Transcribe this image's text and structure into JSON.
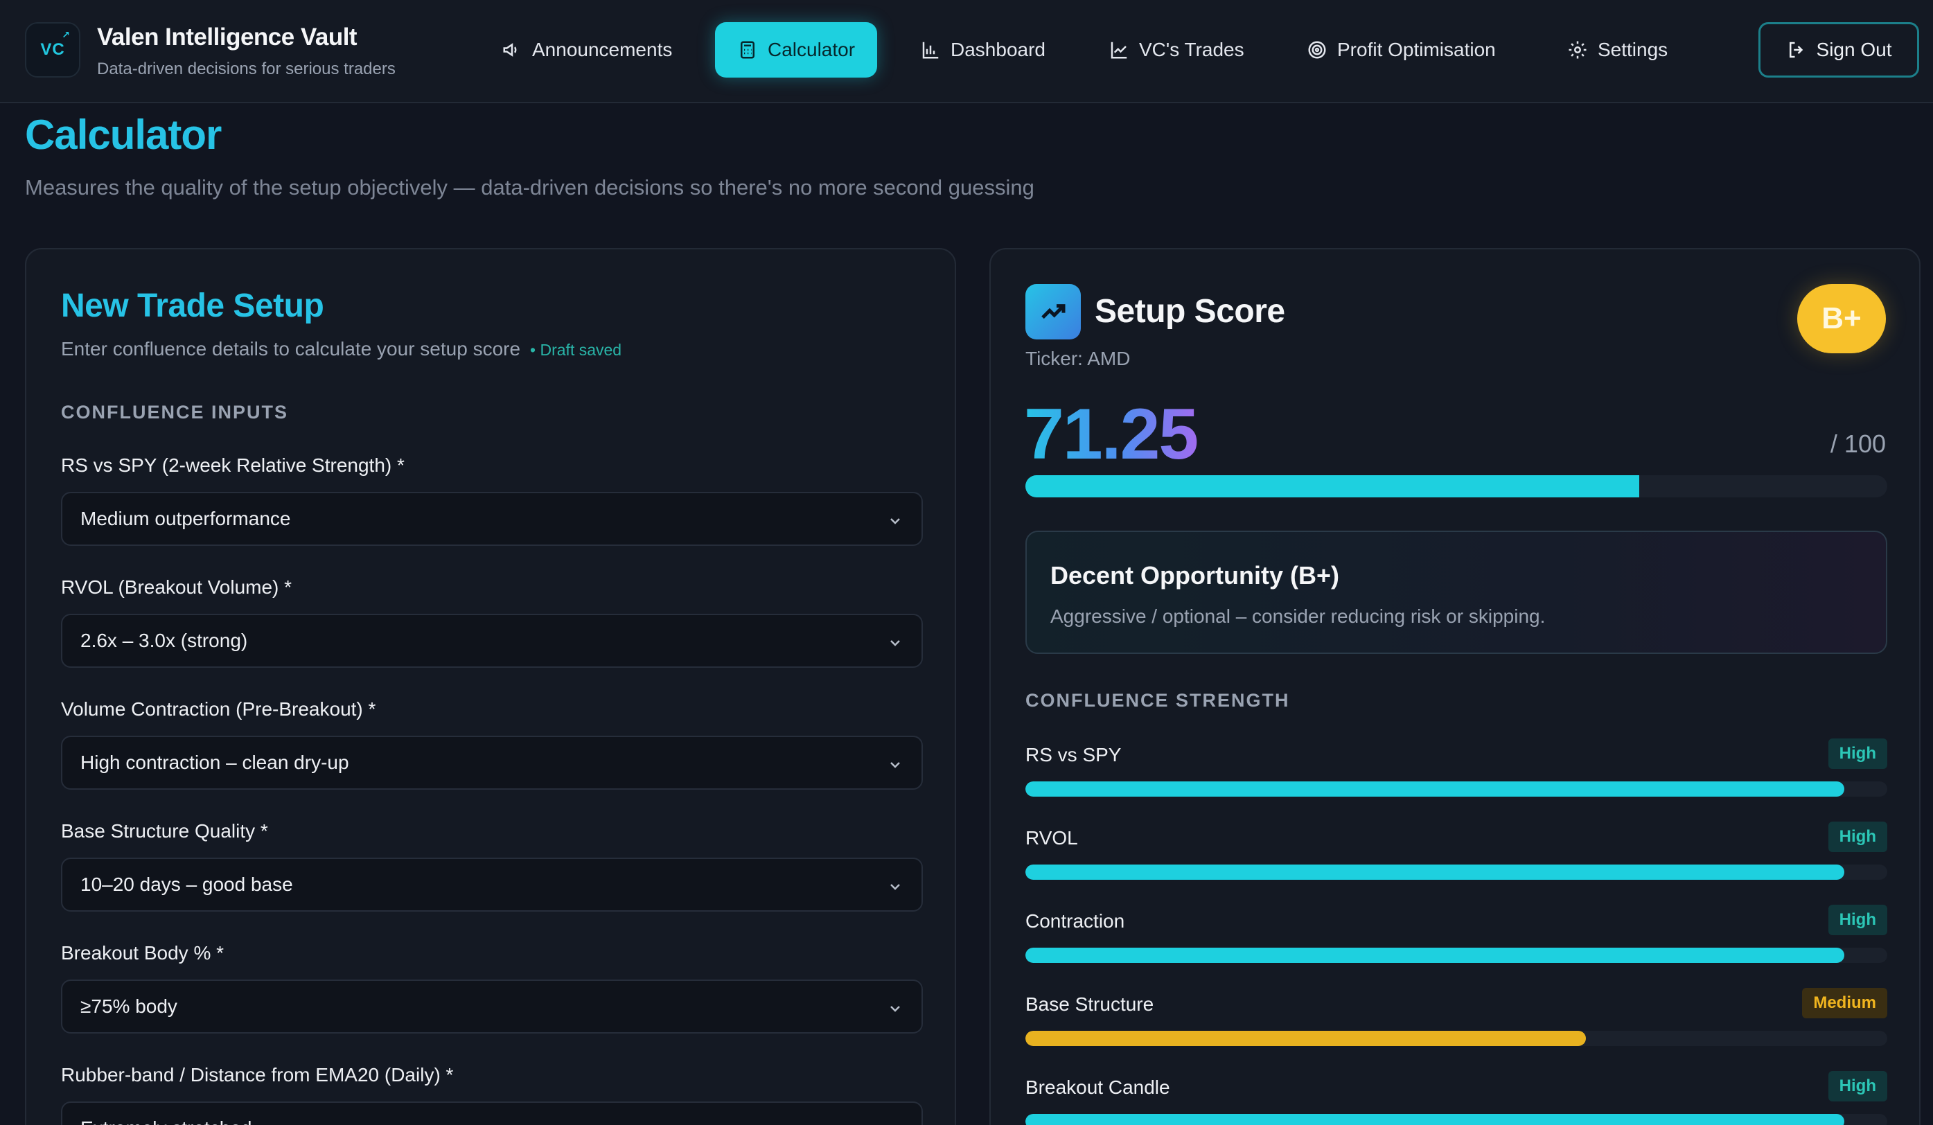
{
  "header": {
    "logo_text": "VC",
    "title": "Valen Intelligence Vault",
    "subtitle": "Data-driven decisions for serious traders",
    "nav": [
      {
        "label": "Announcements",
        "icon": "megaphone-icon"
      },
      {
        "label": "Calculator",
        "icon": "calculator-icon",
        "active": true
      },
      {
        "label": "Dashboard",
        "icon": "bar-chart-icon"
      },
      {
        "label": "VC's Trades",
        "icon": "line-chart-icon"
      },
      {
        "label": "Profit Optimisation",
        "icon": "target-icon"
      },
      {
        "label": "Settings",
        "icon": "gear-icon"
      }
    ],
    "sign_out": "Sign Out"
  },
  "page": {
    "title": "Calculator",
    "subtitle": "Measures the quality of the setup objectively — data-driven decisions so there's no more second guessing"
  },
  "form": {
    "title": "New Trade Setup",
    "subtitle": "Enter confluence details to calculate your setup score",
    "draft_status": "• Draft saved",
    "section_label": "CONFLUENCE INPUTS",
    "fields": [
      {
        "label": "RS vs SPY (2-week Relative Strength) *",
        "value": "Medium outperformance"
      },
      {
        "label": "RVOL (Breakout Volume) *",
        "value": "2.6x – 3.0x (strong)"
      },
      {
        "label": "Volume Contraction (Pre-Breakout) *",
        "value": "High contraction – clean dry-up"
      },
      {
        "label": "Base Structure Quality *",
        "value": "10–20 days – good base"
      },
      {
        "label": "Breakout Body % *",
        "value": "≥75% body"
      },
      {
        "label": "Rubber-band / Distance from EMA20 (Daily) *",
        "value": "Extremely stretched"
      }
    ]
  },
  "score": {
    "title": "Setup Score",
    "ticker": "Ticker: AMD",
    "grade": "B+",
    "value": "71.25",
    "out_of": "/ 100",
    "progress": 0.7125,
    "verdict_title": "Decent Opportunity (B+)",
    "verdict_desc": "Aggressive / optional – consider reducing risk or skipping.",
    "section_label": "CONFLUENCE STRENGTH",
    "items": [
      {
        "name": "RS vs SPY",
        "level": "High",
        "kind": "high",
        "fill": 0.95
      },
      {
        "name": "RVOL",
        "level": "High",
        "kind": "high",
        "fill": 0.95
      },
      {
        "name": "Contraction",
        "level": "High",
        "kind": "high",
        "fill": 0.95
      },
      {
        "name": "Base Structure",
        "level": "Medium",
        "kind": "medium",
        "fill": 0.65
      },
      {
        "name": "Breakout Candle",
        "level": "High",
        "kind": "high",
        "fill": 0.95
      }
    ]
  },
  "colors": {
    "accent": "#1ed0df",
    "title_blue": "#27c3e6",
    "grade_yellow": "#f7c12b",
    "background": "#111520"
  }
}
